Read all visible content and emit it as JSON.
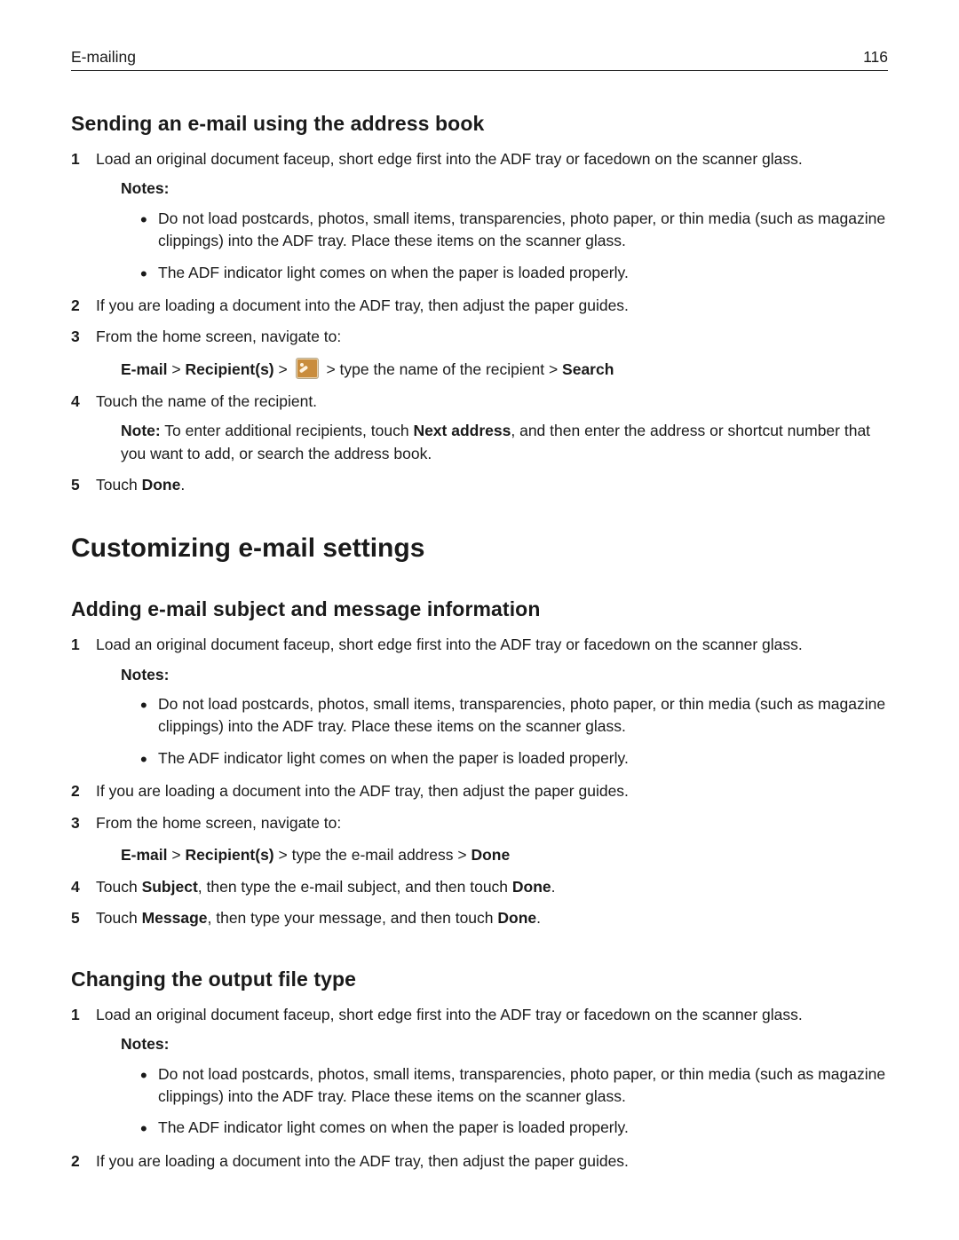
{
  "header": {
    "left": "E-mailing",
    "page": "116"
  },
  "sec1": {
    "title": "Sending an e-mail using the address book",
    "step1": "Load an original document faceup, short edge first into the ADF tray or facedown on the scanner glass.",
    "notesLabel": "Notes:",
    "note1": "Do not load postcards, photos, small items, transparencies, photo paper, or thin media (such as magazine clippings) into the ADF tray. Place these items on the scanner glass.",
    "note2": "The ADF indicator light comes on when the paper is loaded properly.",
    "step2": "If you are loading a document into the ADF tray, then adjust the paper guides.",
    "step3": "From the home screen, navigate to:",
    "nav_email": "E-mail",
    "nav_gt1": " > ",
    "nav_recip": "Recipient(s)",
    "nav_gt2": " > ",
    "nav_tail": " > type the name of the recipient > ",
    "nav_search": "Search",
    "step4": "Touch the name of the recipient.",
    "step4noteLead": "Note:",
    "step4noteMid1": " To enter additional recipients, touch ",
    "step4noteBold": "Next address",
    "step4noteMid2": ", and then enter the address or shortcut number that you want to add, or search the address book.",
    "step5a": "Touch ",
    "step5b": "Done",
    "step5c": "."
  },
  "bigTitle": "Customizing e-mail settings",
  "sec2": {
    "title": "Adding e-mail subject and message information",
    "step1": "Load an original document faceup, short edge first into the ADF tray or facedown on the scanner glass.",
    "notesLabel": "Notes:",
    "note1": "Do not load postcards, photos, small items, transparencies, photo paper, or thin media (such as magazine clippings) into the ADF tray. Place these items on the scanner glass.",
    "note2": "The ADF indicator light comes on when the paper is loaded properly.",
    "step2": "If you are loading a document into the ADF tray, then adjust the paper guides.",
    "step3": "From the home screen, navigate to:",
    "nav_email": "E-mail",
    "nav_gt1": " > ",
    "nav_recip": "Recipient(s)",
    "nav_tail": " > type the e-mail address > ",
    "nav_done": "Done",
    "step4a": "Touch ",
    "step4b": "Subject",
    "step4c": ", then type the e-mail subject, and then touch ",
    "step4d": "Done",
    "step4e": ".",
    "step5a": "Touch ",
    "step5b": "Message",
    "step5c": ", then type your message, and then touch ",
    "step5d": "Done",
    "step5e": "."
  },
  "sec3": {
    "title": "Changing the output file type",
    "step1": "Load an original document faceup, short edge first into the ADF tray or facedown on the scanner glass.",
    "notesLabel": "Notes:",
    "note1": "Do not load postcards, photos, small items, transparencies, photo paper, or thin media (such as magazine clippings) into the ADF tray. Place these items on the scanner glass.",
    "note2": "The ADF indicator light comes on when the paper is loaded properly.",
    "step2": "If you are loading a document into the ADF tray, then adjust the paper guides."
  }
}
